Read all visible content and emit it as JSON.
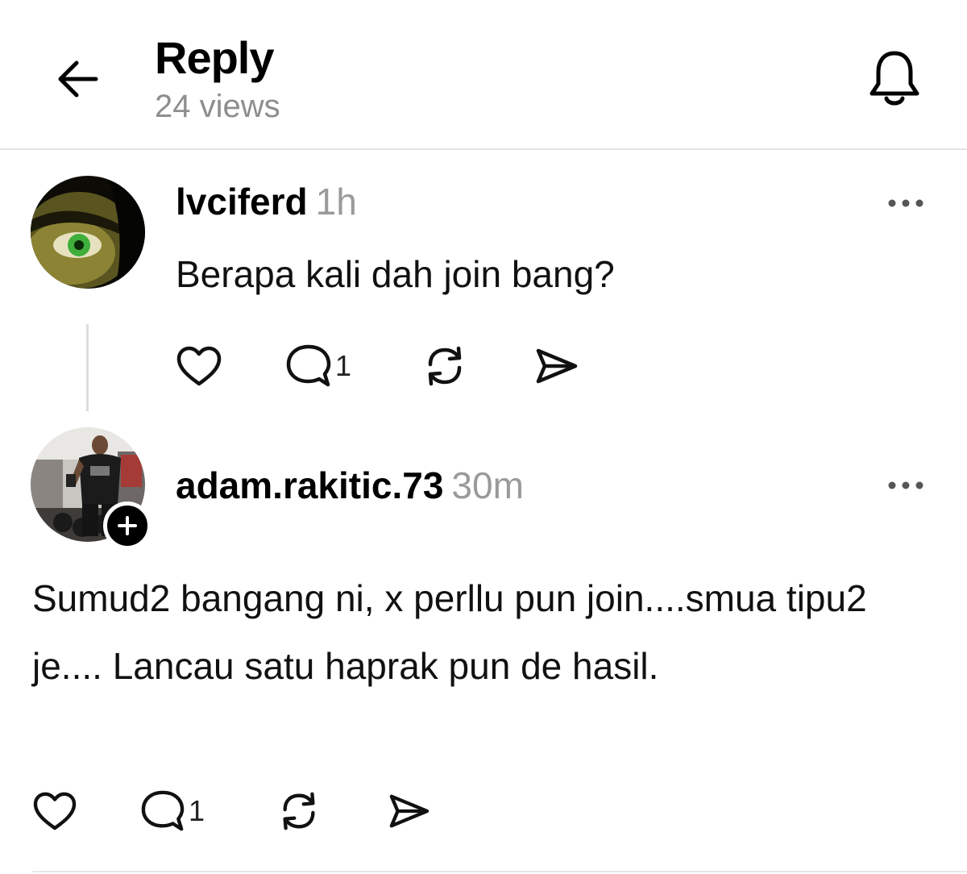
{
  "header": {
    "title": "Reply",
    "views": "24 views"
  },
  "posts": [
    {
      "username": "lvciferd",
      "time": "1h",
      "text": "Berapa kali dah join bang?",
      "reply_count": "1"
    },
    {
      "username": "adam.rakitic.73",
      "time": "30m",
      "text": "Sumud2 bangang ni, x perllu pun join....smua tipu2 je.... Lancau satu haprak pun de hasil.",
      "reply_count": "1"
    }
  ],
  "icons": {
    "back": "arrow-left-icon",
    "notifications": "bell-icon",
    "like": "heart-icon",
    "reply": "comment-icon",
    "repost": "repost-icon",
    "share": "send-icon",
    "more": "ellipsis-icon",
    "follow": "plus-icon"
  }
}
